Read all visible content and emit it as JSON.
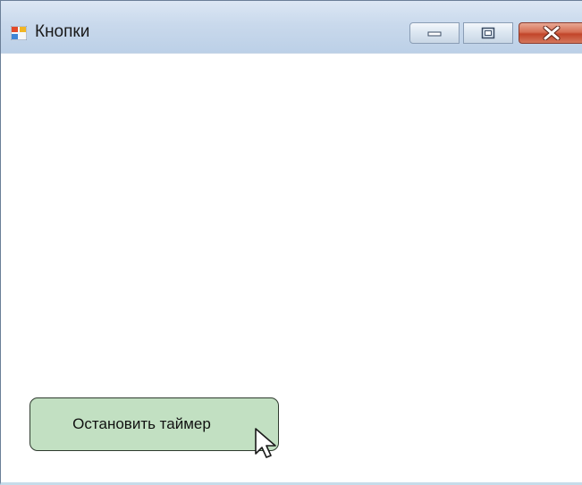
{
  "window": {
    "title": "Кнопки",
    "icon": "windows-form-icon"
  },
  "titlebar_controls": {
    "minimize_icon": "minimize-icon",
    "maximize_icon": "maximize-icon",
    "close_icon": "close-icon"
  },
  "form": {
    "button_label": "Остановить таймер",
    "button_color": "#c2e0c2"
  },
  "cursor": "arrow-pointer-icon"
}
